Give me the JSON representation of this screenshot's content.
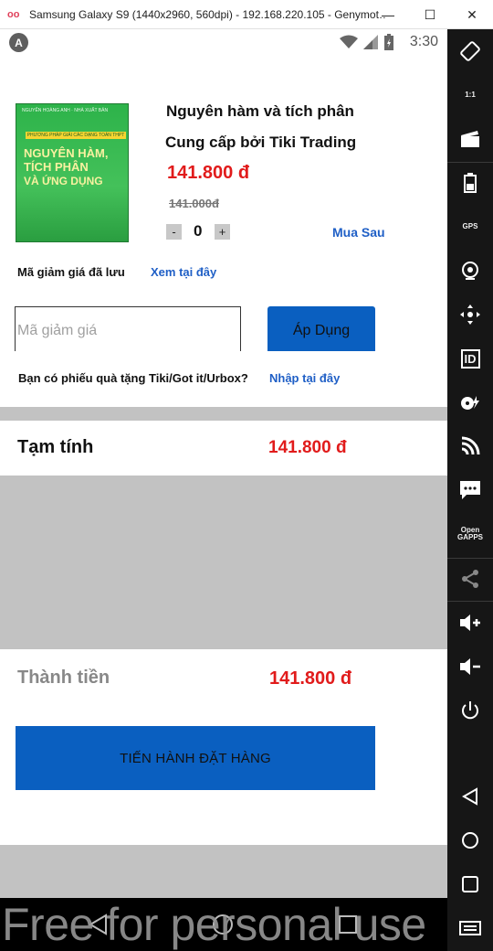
{
  "window": {
    "title": "Samsung Galaxy S9 (1440x2960, 560dpi) - 192.168.220.105 - Genymot…",
    "minimize": "—",
    "maximize": "☐",
    "close": "✕"
  },
  "statusbar": {
    "time": "3:30",
    "badge": "A"
  },
  "product": {
    "cover_tiny": "NGUYỄN HOÀNG ANH · NHÀ XUẤT BẢN",
    "cover_strip": "PHƯƠNG PHÁP GIẢI CÁC DẠNG TOÁN THPT",
    "cover_line1": "NGUYÊN HÀM,",
    "cover_line2": "TÍCH PHÂN",
    "cover_line3": "VÀ ỨNG DỤNG",
    "title": "Nguyên hàm và tích phân",
    "seller": "Cung cấp bởi Tiki Trading",
    "price": "141.800 đ",
    "old_price": "141.000đ",
    "qty_minus": "-",
    "qty": "0",
    "qty_plus": "+",
    "buy_later": "Mua Sau"
  },
  "coupon": {
    "saved_label": "Mã giảm giá đã lưu",
    "view_link": "Xem tại đây",
    "placeholder": "Mã giảm giá",
    "apply": "Áp Dụng"
  },
  "gift": {
    "text": "Bạn có phiếu quà tặng Tiki/Got it/Urbox?",
    "link": "Nhập tại đây"
  },
  "subtotal": {
    "label": "Tạm tính",
    "value": "141.800 đ"
  },
  "total": {
    "label": "Thành tiền",
    "value": "141.800 đ",
    "checkout": "TIẾN HÀNH ĐẶT HÀNG"
  },
  "watermark": "Free for personal use",
  "sidebar": {
    "ratio": "1:1",
    "gps": "GPS",
    "id": "ID",
    "opengapps_1": "Open",
    "opengapps_2": "GAPPS"
  },
  "colors": {
    "accent": "#0a5fc0",
    "price": "#e11b1b",
    "link": "#1f5fc6"
  }
}
